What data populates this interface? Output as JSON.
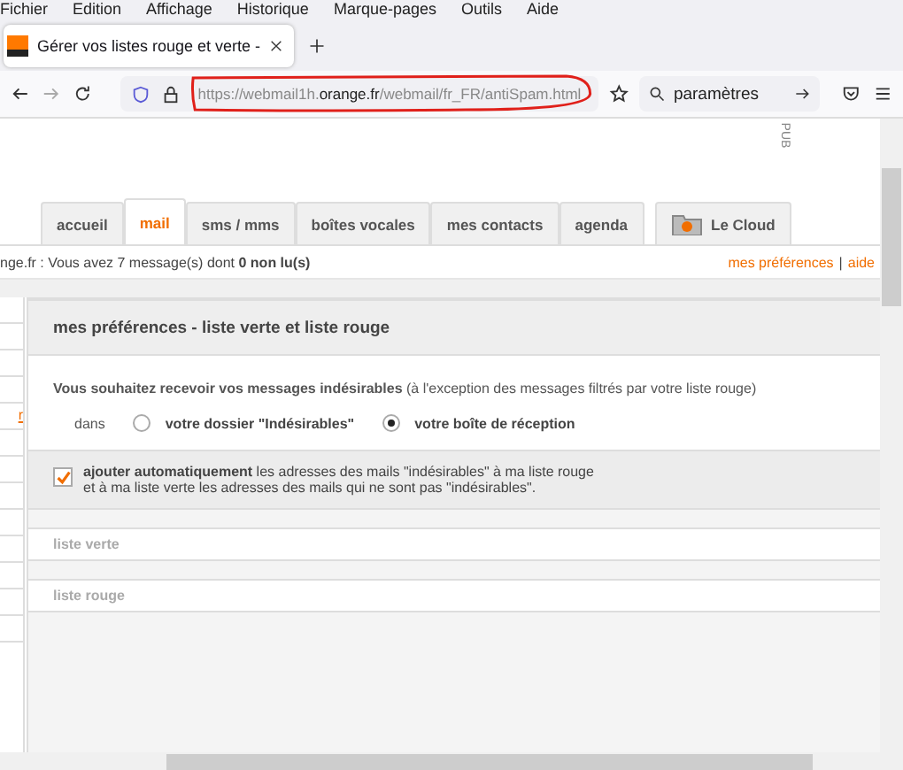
{
  "menu_bar": [
    "Fichier",
    "Edition",
    "Affichage",
    "Historique",
    "Marque-pages",
    "Outils",
    "Aide"
  ],
  "browser_tabs": [
    {
      "title": "Gérer vos listes rouge et verte - ",
      "selected": true
    }
  ],
  "address_bar": {
    "url_host_prefix": "https://webmail1h.",
    "url_domain": "orange.fr",
    "url_path": "/webmail/fr_FR/antiSpam.html"
  },
  "search": {
    "value": "paramètres"
  },
  "ad_label": "PUB",
  "nav_tabs": [
    {
      "label": "accueil",
      "selected": false
    },
    {
      "label": "mail",
      "selected": true
    },
    {
      "label": "sms / mms",
      "selected": false
    },
    {
      "label": "boîtes vocales",
      "selected": false
    },
    {
      "label": "mes contacts",
      "selected": false
    },
    {
      "label": "agenda",
      "selected": false
    },
    {
      "label": "Le Cloud",
      "selected": false,
      "kind": "cloud"
    }
  ],
  "status": {
    "text": "nge.fr : Vous avez 7 message(s) dont  **0 non lu(s)**",
    "links": [
      "mes préférences",
      "aide"
    ],
    "separator": "|"
  },
  "sidebar_link": "r",
  "panel": {
    "title": "mes préférences - liste verte et liste rouge",
    "question": "**Vous souhaitez recevoir vos messages indésirables** (à l'exception des messages filtrés par votre liste rouge)",
    "radio_label": "dans",
    "options": [
      {
        "label": "votre dossier \"Indésirables\"",
        "selected": false
      },
      {
        "label": "votre boîte de réception",
        "selected": true
      }
    ],
    "auto_add": {
      "checked": true,
      "text": "**ajouter automatiquement** les adresses des mails \"indésirables\" à ma liste rouge",
      "text_line2": "et à ma liste verte les adresses des mails qui ne sont pas \"indésirables\"."
    },
    "lists": [
      "liste verte",
      "liste rouge"
    ]
  }
}
